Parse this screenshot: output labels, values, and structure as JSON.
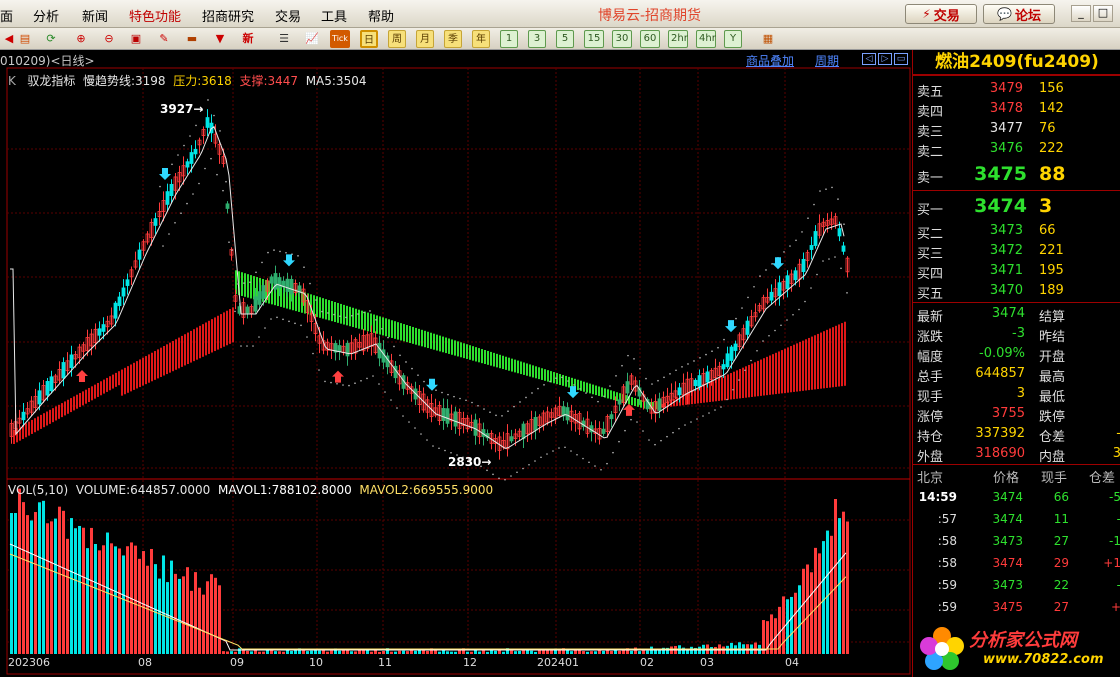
{
  "menu": {
    "items": [
      "面",
      "分析",
      "新闻",
      "特色功能",
      "招商研究",
      "交易",
      "工具",
      "帮助"
    ],
    "title": "博易云-招商期货",
    "trade_button": "交易",
    "forum_button": "论坛",
    "window_controls": [
      "_",
      "□",
      "×"
    ]
  },
  "toolbar": {
    "periods": [
      "日",
      "周",
      "月",
      "季",
      "年"
    ],
    "minutes": [
      "1",
      "3",
      "5",
      "15",
      "30",
      "60",
      "2hr",
      "4hr",
      "Y"
    ],
    "tick_label": "Tick",
    "new_label": "新"
  },
  "chart": {
    "code_label": "010209)<日线>",
    "overlay_link": "商品叠加",
    "period_link": "周期",
    "indicator": {
      "prefix": "K",
      "name": "驭龙指标",
      "slow_trend": "慢趋势线:3198",
      "resistance": "压力:3618",
      "support": "支撑:3447",
      "ma5": "MA5:3504"
    },
    "volume": {
      "label": "VOL(5,10)",
      "volume": "VOLUME:644857.0000",
      "mavol1": "MAVOL1:788102.8000",
      "mavol2": "MAVOL2:669555.9000"
    },
    "high_marker": "3927",
    "low_marker": "2830",
    "x_ticks": [
      "202306",
      "08",
      "09",
      "10",
      "11",
      "12",
      "202401",
      "02",
      "03",
      "04"
    ],
    "colors": {
      "up": "#ff3b3b",
      "down": "#00e5e5",
      "trend_up": "#e01818",
      "trend_down": "#2ee02e"
    }
  },
  "chart_data": {
    "type": "candlestick",
    "series_note": "K-line daily, fu2409",
    "high": 3927,
    "low": 2830,
    "last": 3474
  },
  "quote": {
    "title": "燃油2409(fu2409)",
    "asks": [
      {
        "label": "卖五",
        "price": "3479",
        "vol": "156",
        "pc": "#ff3b3b"
      },
      {
        "label": "卖四",
        "price": "3478",
        "vol": "142",
        "pc": "#ff3b3b"
      },
      {
        "label": "卖三",
        "price": "3477",
        "vol": "76",
        "pc": "#e6e6e6"
      },
      {
        "label": "卖二",
        "price": "3476",
        "vol": "222",
        "pc": "#2ee02e"
      }
    ],
    "ask1": {
      "label": "卖一",
      "price": "3475",
      "vol": "88"
    },
    "bid1": {
      "label": "买一",
      "price": "3474",
      "vol": "3"
    },
    "bids": [
      {
        "label": "买二",
        "price": "3473",
        "vol": "66"
      },
      {
        "label": "买三",
        "price": "3472",
        "vol": "221"
      },
      {
        "label": "买四",
        "price": "3471",
        "vol": "195"
      },
      {
        "label": "买五",
        "price": "3470",
        "vol": "189"
      }
    ],
    "stats": [
      {
        "l": "最新",
        "v": "3474",
        "vc": "#2ee02e",
        "l2": "结算",
        "v2": ""
      },
      {
        "l": "涨跌",
        "v": "-3",
        "vc": "#2ee02e",
        "l2": "昨结",
        "v2": ""
      },
      {
        "l": "幅度",
        "v": "-0.09%",
        "vc": "#2ee02e",
        "l2": "开盘",
        "v2": ""
      },
      {
        "l": "总手",
        "v": "644857",
        "vc": "#ffd400",
        "l2": "最高",
        "v2": ""
      },
      {
        "l": "现手",
        "v": "3",
        "vc": "#ffd400",
        "l2": "最低",
        "v2": ""
      },
      {
        "l": "涨停",
        "v": "3755",
        "vc": "#ff3b3b",
        "l2": "跌停",
        "v2": ""
      },
      {
        "l": "持仓",
        "v": "337392",
        "vc": "#ffd400",
        "l2": "仓差",
        "v2": "-"
      },
      {
        "l": "外盘",
        "v": "318690",
        "vc": "#ff3b3b",
        "l2": "内盘",
        "v2": "3"
      }
    ],
    "tick_header": {
      "place": "北京",
      "price": "价格",
      "vol": "现手",
      "chg": "仓差"
    },
    "ticks": [
      {
        "time": "14:59",
        "price": "3474",
        "vol": "66",
        "chg": "-5",
        "cc": "#2ee02e"
      },
      {
        "time": ":57",
        "price": "3474",
        "vol": "11",
        "chg": "-",
        "cc": "#2ee02e"
      },
      {
        "time": ":58",
        "price": "3473",
        "vol": "27",
        "chg": "-1",
        "cc": "#2ee02e"
      },
      {
        "time": ":58",
        "price": "3474",
        "vol": "29",
        "chg": "+1",
        "cc": "#ff3b3b"
      },
      {
        "time": ":59",
        "price": "3473",
        "vol": "22",
        "chg": "-",
        "cc": "#2ee02e"
      },
      {
        "time": ":59",
        "price": "3475",
        "vol": "27",
        "chg": "+",
        "cc": "#ff3b3b"
      }
    ],
    "watermark": {
      "name": "分析家公式网",
      "url": "www.70822.com"
    }
  }
}
